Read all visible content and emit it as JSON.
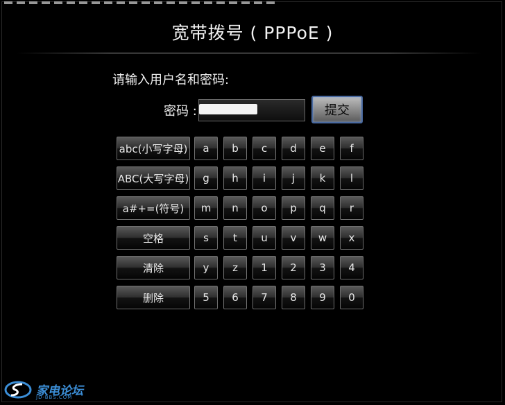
{
  "title": "宽带拨号 ( PPPoE )",
  "prompt": "请输入用户名和密码:",
  "password": {
    "label": "密码 :"
  },
  "submit_label": "提交",
  "mode_keys": [
    {
      "name": "lowercase-mode-button",
      "label": "abc(小写字母)"
    },
    {
      "name": "uppercase-mode-button",
      "label": "ABC(大写字母)"
    },
    {
      "name": "symbol-mode-button",
      "label": "a#+=(符号)"
    },
    {
      "name": "space-button",
      "label": "空格"
    },
    {
      "name": "clear-button",
      "label": "清除"
    },
    {
      "name": "delete-button",
      "label": "删除"
    }
  ],
  "keys": [
    [
      "a",
      "b",
      "c",
      "d",
      "e",
      "f"
    ],
    [
      "g",
      "h",
      "i",
      "j",
      "k",
      "l"
    ],
    [
      "m",
      "n",
      "o",
      "p",
      "q",
      "r"
    ],
    [
      "s",
      "t",
      "u",
      "v",
      "w",
      "x"
    ],
    [
      "y",
      "z",
      "1",
      "2",
      "3",
      "4"
    ],
    [
      "5",
      "6",
      "7",
      "8",
      "9",
      "0"
    ]
  ],
  "watermark": {
    "text": "家电论坛",
    "sub": "JD-BBS.COM",
    "color": "#3c8fd8"
  }
}
